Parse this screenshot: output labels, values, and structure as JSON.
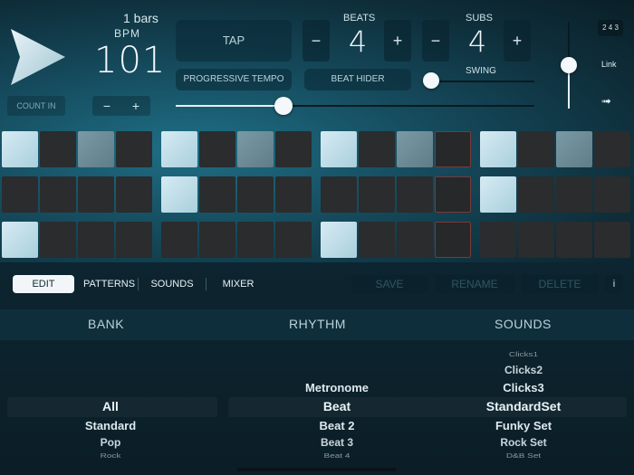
{
  "header": {
    "bars": "1 bars",
    "bpm_label": "BPM",
    "bpm_value": "101",
    "count_in": "COUNT IN",
    "minus": "−",
    "plus": "+",
    "tap": "TAP",
    "progressive_tempo": "PROGRESSIVE TEMPO",
    "beat_hider": "BEAT HIDER",
    "beats_label": "BEATS",
    "beats_value": "4",
    "subs_label": "SUBS",
    "subs_value": "4",
    "swing_label": "SWING",
    "swing_level": 0.0,
    "tempo_level": 0.3,
    "volume_level": 0.5,
    "link_icon_text": "2 4 3",
    "link_label": "Link",
    "arrow_icon": "➟"
  },
  "grid": {
    "rows": [
      [
        "on",
        "off",
        "mid",
        "off",
        "on",
        "off",
        "mid",
        "off",
        "on",
        "off",
        "mid",
        "cur",
        "on",
        "off",
        "mid",
        "off"
      ],
      [
        "off",
        "off",
        "off",
        "off",
        "on",
        "off",
        "off",
        "off",
        "off",
        "off",
        "off",
        "cur",
        "on",
        "off",
        "off",
        "off"
      ],
      [
        "on",
        "off",
        "off",
        "off",
        "off",
        "off",
        "off",
        "off",
        "on",
        "off",
        "off",
        "cur",
        "off",
        "off",
        "off",
        "off"
      ]
    ]
  },
  "tabs": {
    "items": [
      "EDIT",
      "PATTERNS",
      "SOUNDS",
      "MIXER"
    ],
    "active": "EDIT",
    "save": "SAVE",
    "rename": "RENAME",
    "delete": "DELETE",
    "info": "i"
  },
  "columns": {
    "bank": "BANK",
    "rhythm": "RHYTHM",
    "sounds": "SOUNDS"
  },
  "pickers": {
    "bank": [
      "All",
      "Standard",
      "Pop",
      "Rock"
    ],
    "bank_selected": "All",
    "rhythm": [
      "Metronome",
      "Beat",
      "Beat 2",
      "Beat 3",
      "Beat 4"
    ],
    "rhythm_selected": "Beat",
    "sounds": [
      "Clicks1",
      "Clicks2",
      "Clicks3",
      "StandardSet",
      "Funky Set",
      "Rock Set",
      "D&B Set"
    ],
    "sounds_selected": "StandardSet"
  }
}
